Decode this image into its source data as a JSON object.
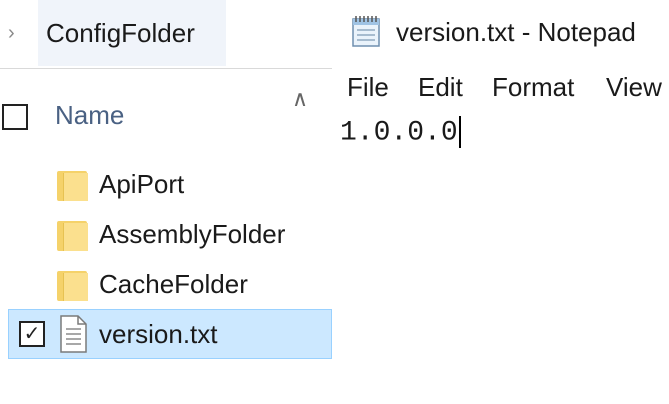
{
  "explorer": {
    "breadcrumb": {
      "folder": "ConfigFolder"
    },
    "header": {
      "name_label": "Name"
    },
    "items": [
      {
        "label": "ApiPort",
        "type": "folder",
        "icon": "folder-icon"
      },
      {
        "label": "AssemblyFolder",
        "type": "folder",
        "icon": "folder-icon"
      },
      {
        "label": "CacheFolder",
        "type": "folder",
        "icon": "folder-icon"
      },
      {
        "label": "version.txt",
        "type": "file",
        "icon": "text-file-icon",
        "checked": true,
        "selected": true
      }
    ]
  },
  "notepad": {
    "title": "version.txt - Notepad",
    "menu": [
      "File",
      "Edit",
      "Format",
      "View"
    ],
    "content": "1.0.0.0"
  },
  "colors": {
    "selection_bg": "#cce8ff",
    "selection_border": "#99d1ff",
    "folder_yellow": "#f5d26a",
    "header_text": "#4a6183"
  }
}
